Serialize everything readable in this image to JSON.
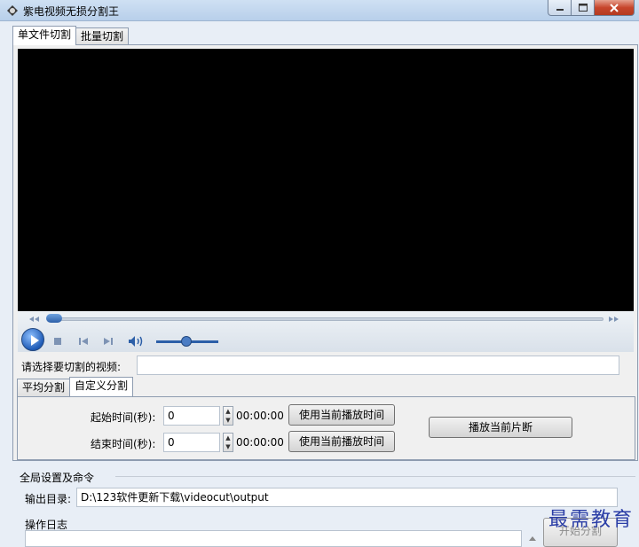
{
  "window": {
    "title": "紫电视频无损分割王"
  },
  "main_tabs": [
    {
      "label": "单文件切割",
      "active": true
    },
    {
      "label": "批量切割",
      "active": false
    }
  ],
  "player": {
    "icons": [
      "rewind-icon",
      "fast-forward-icon",
      "play-icon",
      "stop-icon",
      "previous-icon",
      "next-icon",
      "volume-icon"
    ]
  },
  "select_video": {
    "label": "请选择要切割的视频:",
    "value": ""
  },
  "split_tabs": [
    {
      "label": "平均分割",
      "active": false
    },
    {
      "label": "自定义分割",
      "active": true
    }
  ],
  "custom_split": {
    "start_label": "起始时间(秒):",
    "start_value": "0",
    "start_time": "00:00:00",
    "end_label": "结束时间(秒):",
    "end_value": "0",
    "end_time": "00:00:00",
    "use_current_label": "使用当前播放时间",
    "play_segment_label": "播放当前片断"
  },
  "global": {
    "title": "全局设置及命令",
    "output_label": "输出目录:",
    "output_value": "D:\\123软件更新下载\\videocut\\output",
    "log_label": "操作日志",
    "start_button": "开始分割"
  },
  "watermark": "最需教育"
}
